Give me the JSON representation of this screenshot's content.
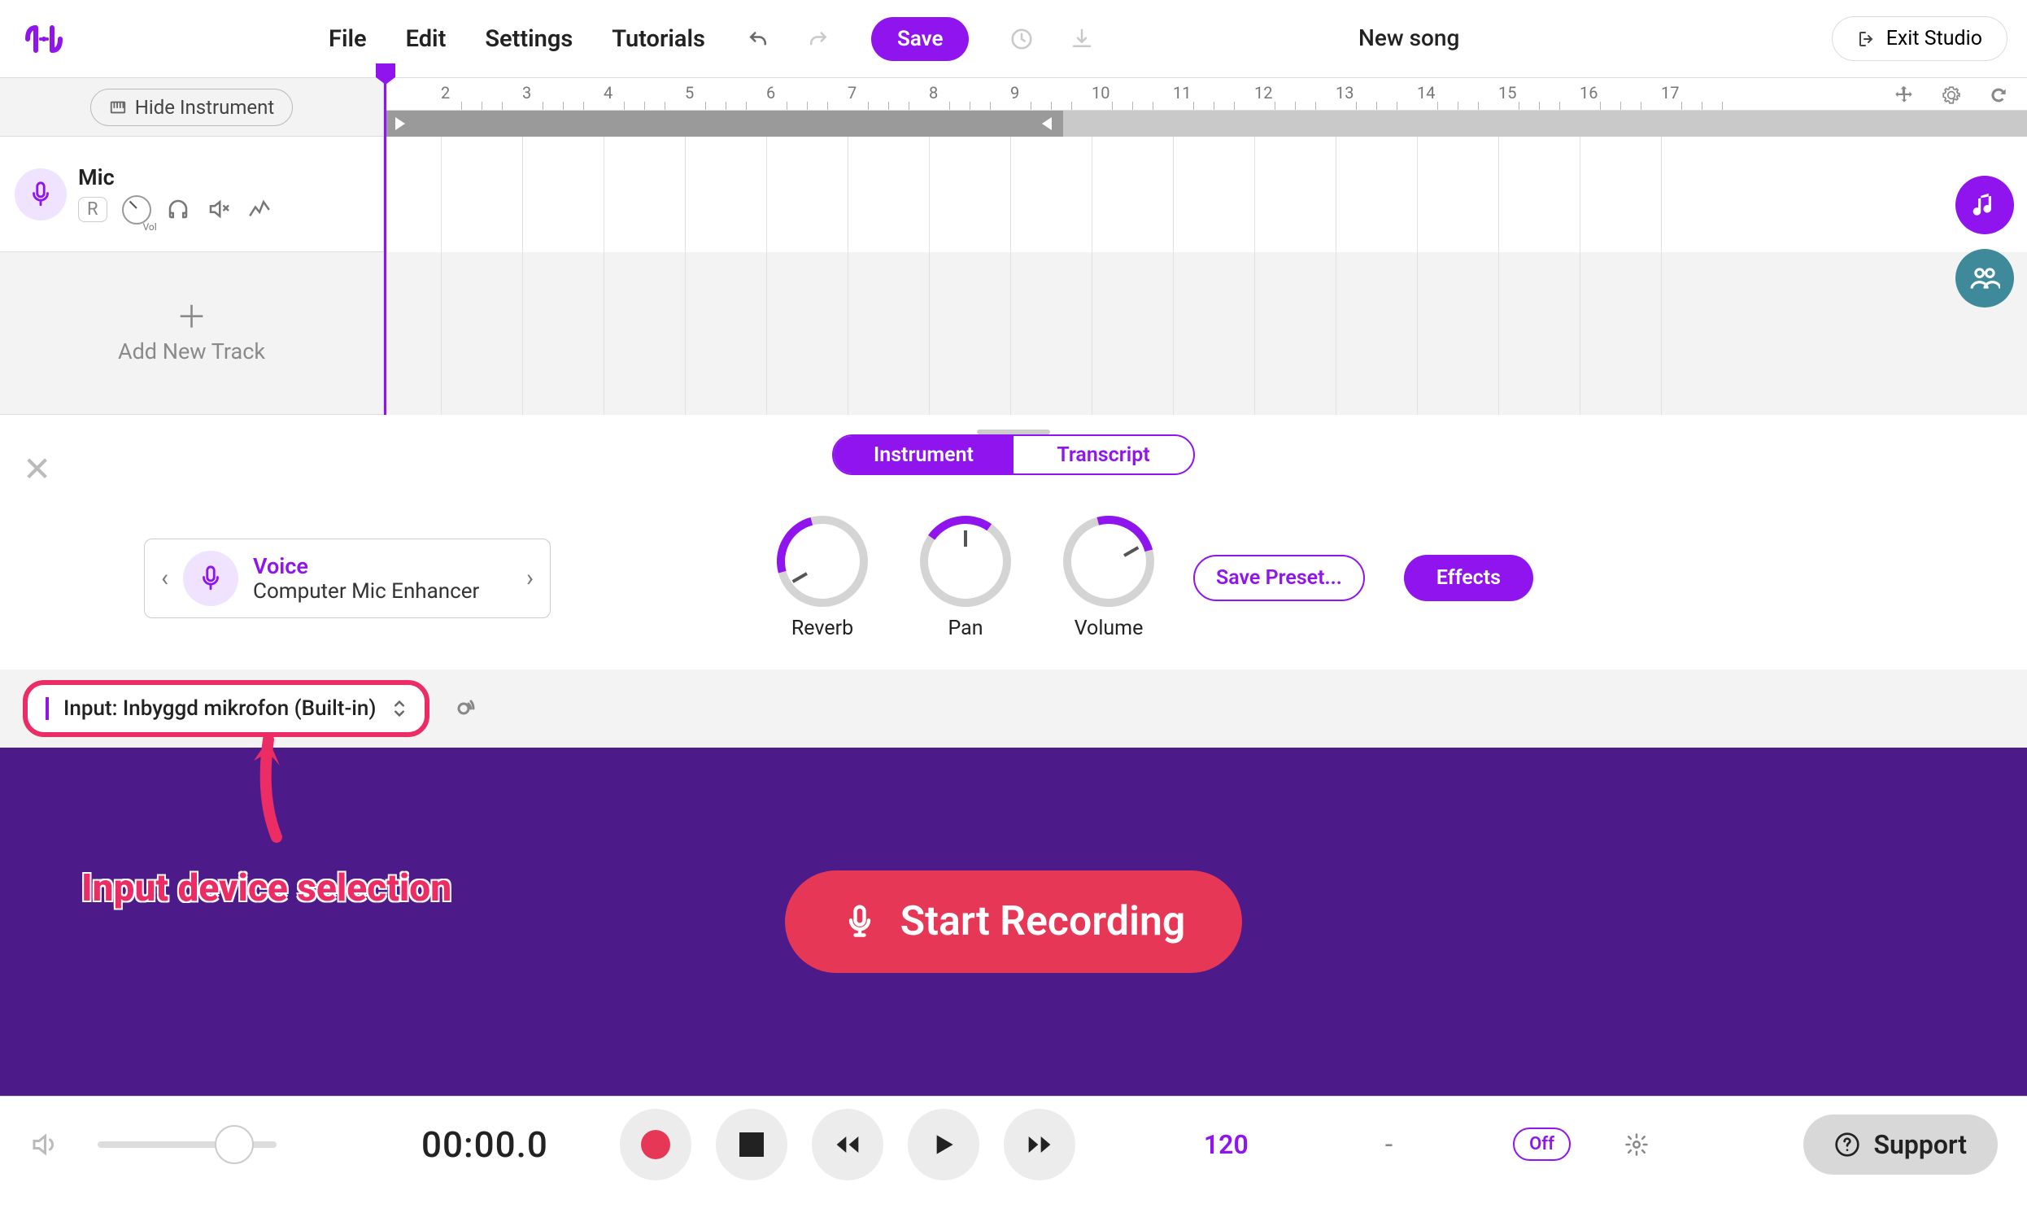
{
  "menu": {
    "file": "File",
    "edit": "Edit",
    "settings": "Settings",
    "tutorials": "Tutorials",
    "save": "Save"
  },
  "song_name": "New song",
  "exit": "Exit Studio",
  "hide_instrument": "Hide Instrument",
  "track": {
    "name": "Mic",
    "rec": "R",
    "vol_label": "Vol"
  },
  "add_track": "Add New Track",
  "ruler_numbers": [
    "2",
    "3",
    "4",
    "5",
    "6",
    "7",
    "8",
    "9",
    "10",
    "11",
    "12",
    "13",
    "14",
    "15",
    "16",
    "17"
  ],
  "tabs": {
    "instrument": "Instrument",
    "transcript": "Transcript"
  },
  "voice": {
    "title": "Voice",
    "subtitle": "Computer Mic Enhancer"
  },
  "knobs": {
    "reverb": "Reverb",
    "pan": "Pan",
    "volume": "Volume"
  },
  "buttons": {
    "save_preset": "Save Preset...",
    "effects": "Effects"
  },
  "input_selector": "Input: Inbyggd mikrofon (Built-in)",
  "annotation": "Input device selection",
  "record": "Start Recording",
  "transport": {
    "time": "00:00.0",
    "bpm": "120",
    "sig": "-",
    "metronome": "Off"
  },
  "support": "Support"
}
